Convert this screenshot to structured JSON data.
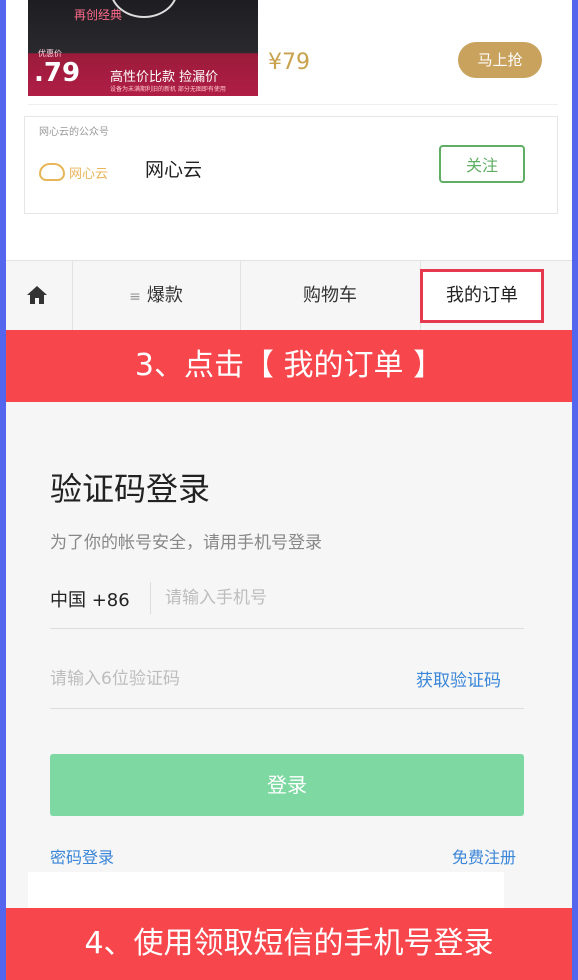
{
  "product": {
    "top_label": "再创经典",
    "old_label": "优惠价",
    "old_price": ".79",
    "slogan": "高性价比款 捡漏价",
    "fine_print": "设备为未满期利旧的新机 部分无图即有使用",
    "price": "¥79",
    "buy_label": "马上抢"
  },
  "official_account": {
    "caption": "网心云的公众号",
    "logo_text": "网心云",
    "name": "网心云",
    "follow_label": "关注"
  },
  "nav": {
    "home_icon": "home-icon",
    "hot_glyph": "≡",
    "hot_label": "爆款",
    "cart_label": "购物车",
    "orders_label": "我的订单"
  },
  "banners": {
    "step3": "3、点击【 我的订单 】",
    "step4": "4、使用领取短信的手机号登录"
  },
  "login": {
    "title": "验证码登录",
    "subtitle": "为了你的帐号安全，请用手机号登录",
    "country_code": "中国 +86",
    "phone_placeholder": "请输入手机号",
    "code_placeholder": "请输入6位验证码",
    "get_code_label": "获取验证码",
    "login_label": "登录",
    "password_login_label": "密码登录",
    "register_label": "免费注册"
  },
  "colors": {
    "accent_red": "#f7474d",
    "gold": "#c9a25e",
    "green": "#5fae64",
    "link_blue": "#3a86d8",
    "login_green": "#7dd8a2",
    "frame_blue": "#5566ee"
  }
}
